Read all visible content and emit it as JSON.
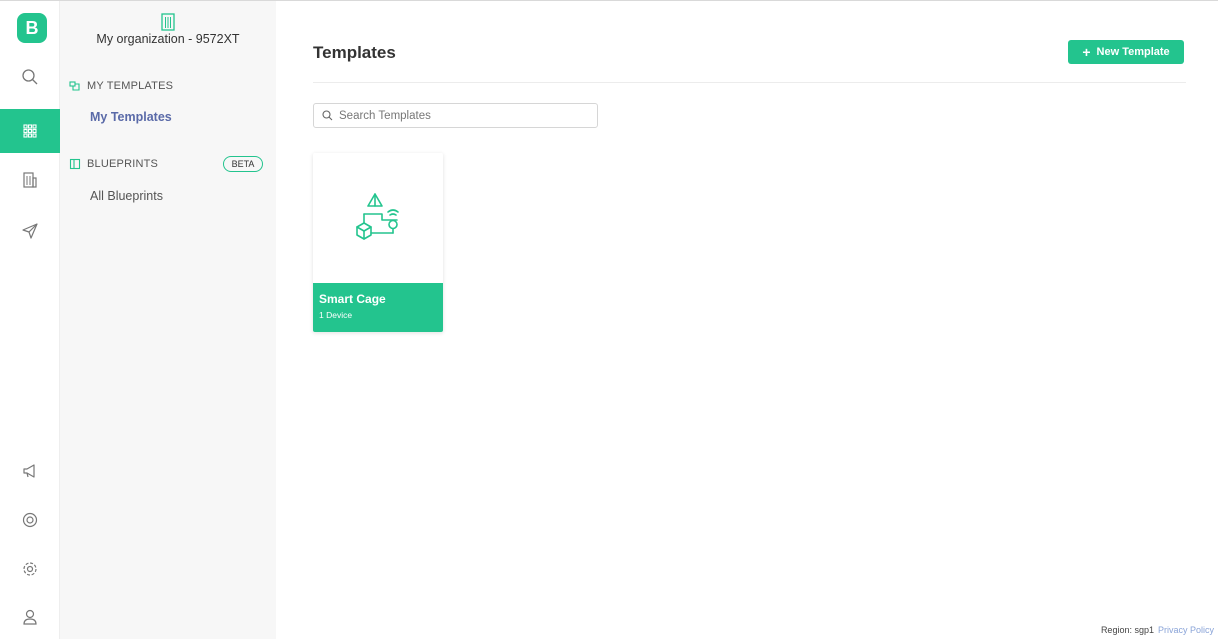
{
  "brand": {
    "logo_letter": "B",
    "accent": "#23c48e"
  },
  "rail": {
    "items": [
      {
        "icon": "search-icon"
      },
      {
        "icon": "grid-icon",
        "active": true
      },
      {
        "icon": "building-icon"
      },
      {
        "icon": "send-icon"
      },
      {
        "icon": "megaphone-icon"
      },
      {
        "icon": "lifebuoy-icon"
      },
      {
        "icon": "gear-icon"
      },
      {
        "icon": "user-icon"
      }
    ]
  },
  "sidebar": {
    "org_name": "My organization - 9572XT",
    "my_templates_header": "MY TEMPLATES",
    "my_templates_link": "My Templates",
    "blueprints_header": "BLUEPRINTS",
    "beta_badge": "BETA",
    "all_blueprints_link": "All Blueprints"
  },
  "main": {
    "title": "Templates",
    "new_button": "New Template",
    "search_placeholder": "Search Templates",
    "templates": [
      {
        "name": "Smart Cage",
        "devices": "1 Device"
      }
    ]
  },
  "footer": {
    "region": "Region: sgp1",
    "privacy": "Privacy Policy"
  }
}
